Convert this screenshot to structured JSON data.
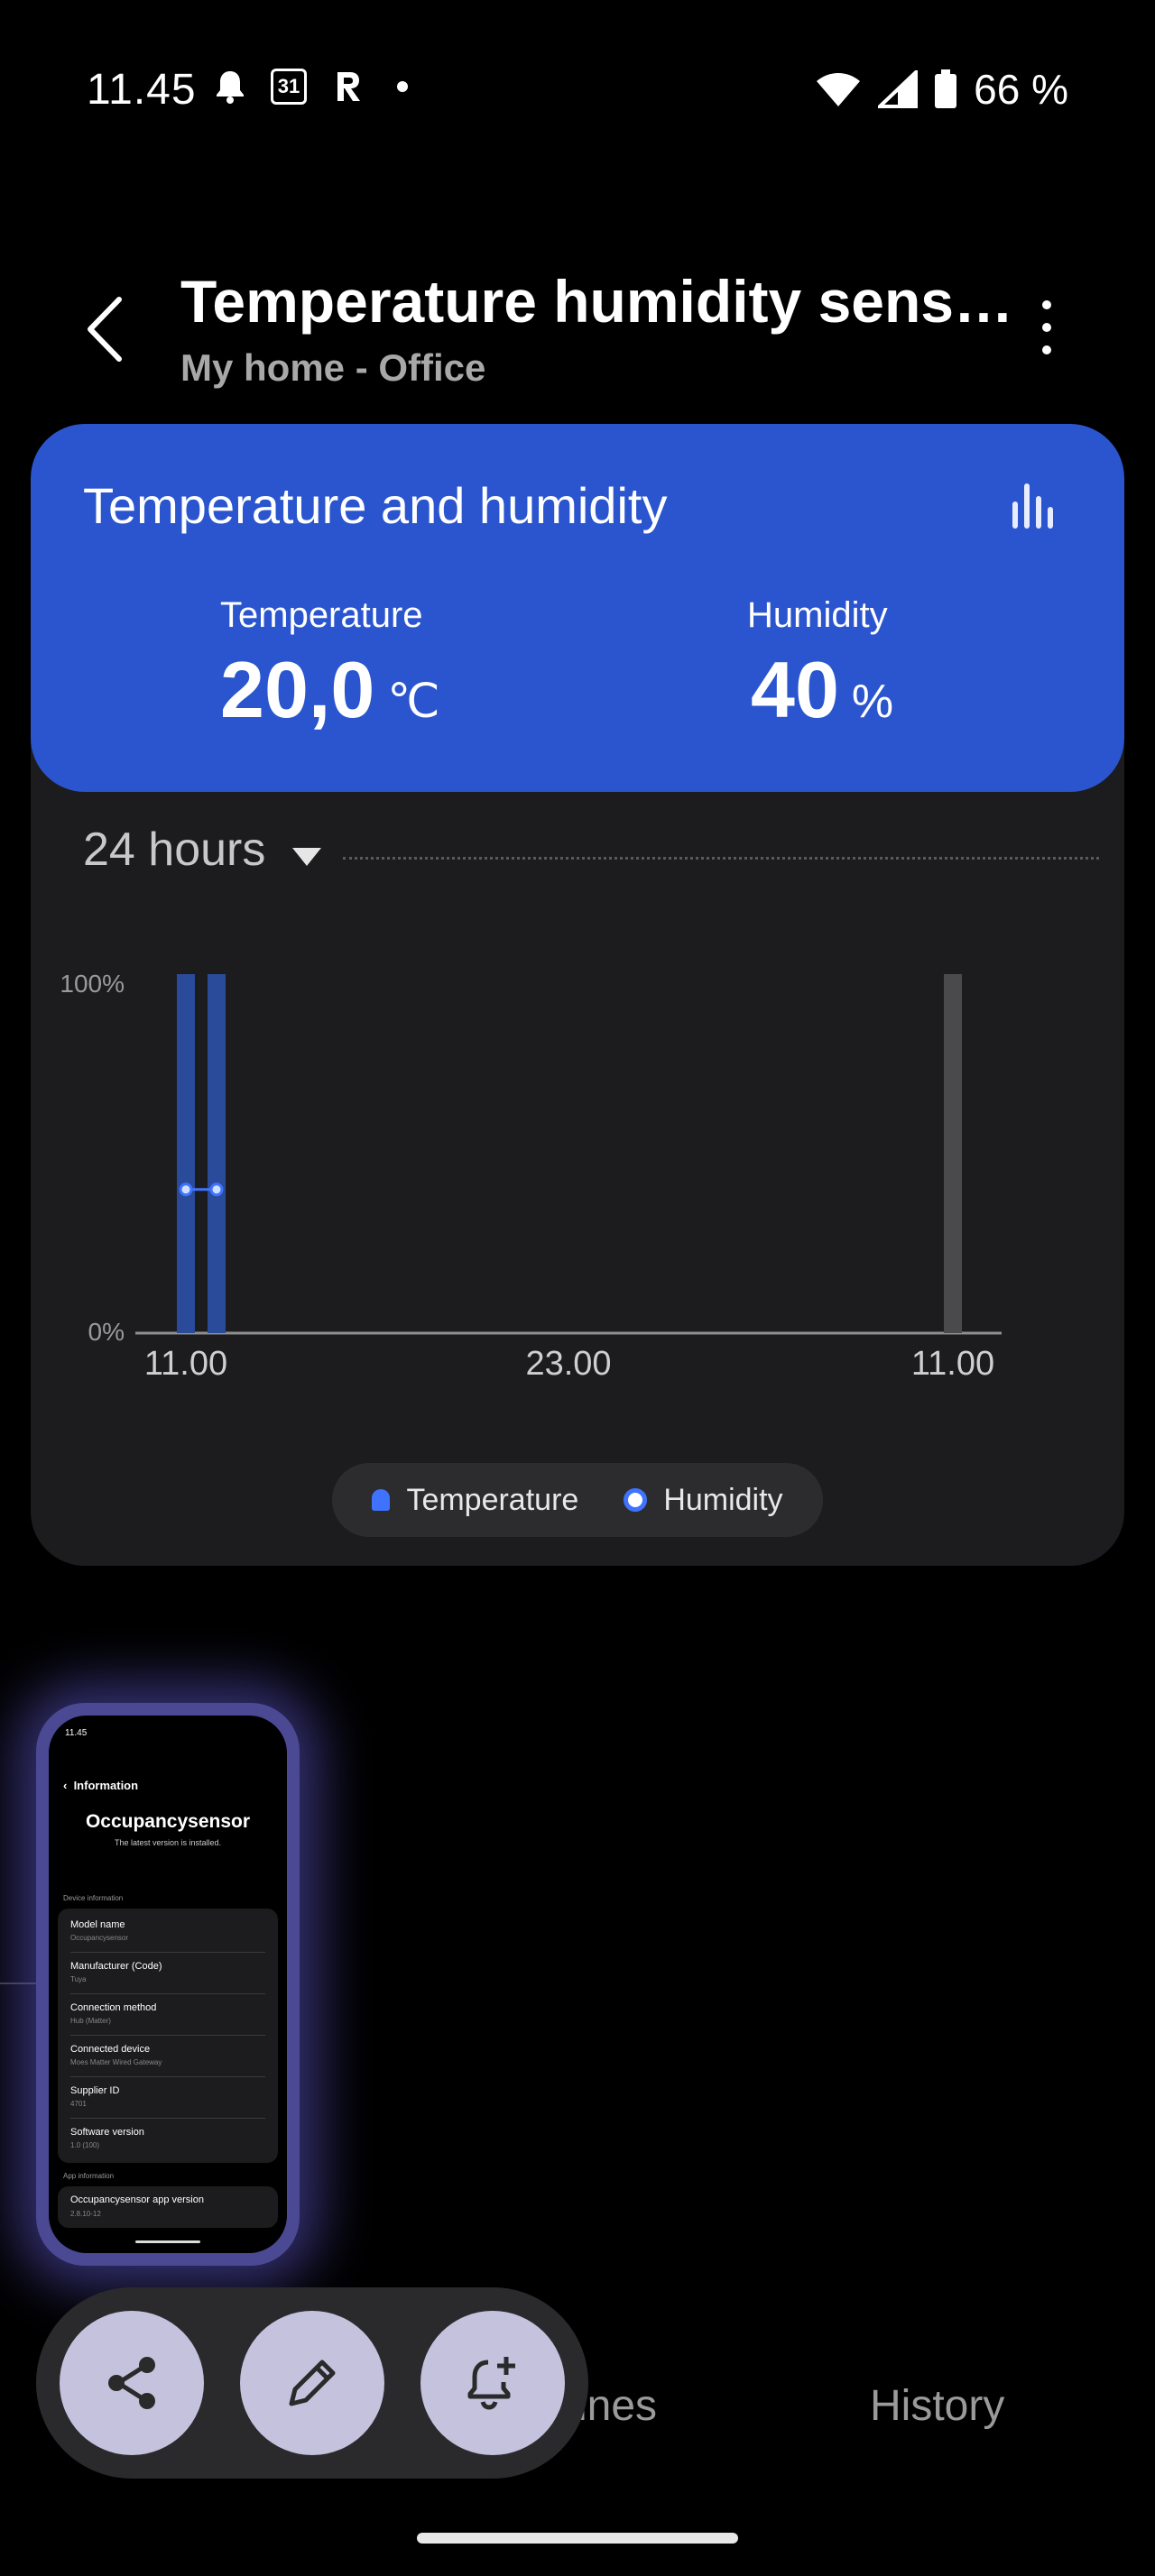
{
  "status": {
    "time": "11.45",
    "calendar_day": "31",
    "battery": "66 %"
  },
  "header": {
    "title": "Temperature humidity sens…",
    "subtitle": "My home - Office"
  },
  "card": {
    "title": "Temperature and humidity",
    "temperature": {
      "label": "Temperature",
      "value": "20,0",
      "unit": "℃"
    },
    "humidity": {
      "label": "Humidity",
      "value": "40",
      "unit": "%"
    },
    "range": "24 hours"
  },
  "chart_data": {
    "type": "bar",
    "x_ticks": [
      "11.00",
      "23.00",
      "11.00"
    ],
    "y_ticks": [
      "100%",
      "0%"
    ],
    "ylim": [
      0,
      100
    ],
    "legend": [
      "Temperature",
      "Humidity"
    ],
    "legend_position": "bottom",
    "series": [
      {
        "name": "Temperature",
        "values": [
          100,
          100
        ],
        "color": "#2a4a9a"
      },
      {
        "name": "Humidity",
        "values": [
          40,
          40
        ],
        "color": "#3f73ff"
      }
    ]
  },
  "thumbnail": {
    "status_time": "11.45",
    "header": "Information",
    "device_name": "Occupancysensor",
    "version_note": "The latest version is installed.",
    "section_device": "Device information",
    "rows": [
      {
        "label": "Model name",
        "value": "Occupancysensor"
      },
      {
        "label": "Manufacturer (Code)",
        "value": "Tuya"
      },
      {
        "label": "Connection method",
        "value": "Hub (Matter)"
      },
      {
        "label": "Connected device",
        "value": "Moes Matter Wired Gateway"
      },
      {
        "label": "Supplier ID",
        "value": "4701"
      },
      {
        "label": "Software version",
        "value": "1.0 (100)"
      }
    ],
    "section_app": "App information",
    "app_row": {
      "label": "Occupancysensor app version",
      "value": "2.8.10-12"
    }
  },
  "bottom_nav": {
    "routines_partial": "ines",
    "history": "History"
  },
  "colors": {
    "accent": "#2a55cf",
    "card_bg": "#1c1c1e",
    "fab": "#c5c2de"
  }
}
